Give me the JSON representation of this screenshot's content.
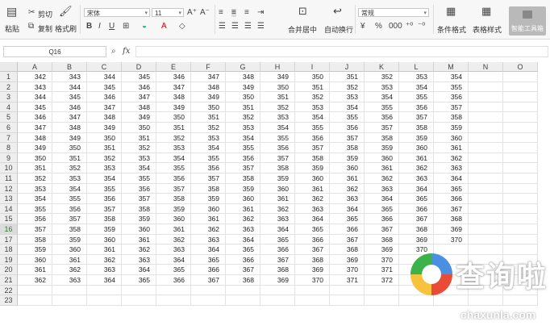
{
  "ribbon": {
    "paste": "粘贴",
    "cut": "剪切",
    "copy": "复制",
    "format_painter": "格式刷",
    "font_name": "宋体",
    "font_size": "11",
    "merge_center": "合并居中",
    "wrap_text": "自动换行",
    "number_format": "常规",
    "conditional_format": "条件格式",
    "table_style": "表格样式",
    "smart_toolbox": "智能工具箱",
    "icons": [
      "paste-icon",
      "cut-icon",
      "copy-icon",
      "format-painter-icon",
      "bold-icon",
      "italic-icon",
      "underline-icon",
      "border-icon",
      "fill-color-icon",
      "font-color-icon",
      "clear-icon",
      "align-icon",
      "currency-icon",
      "percent-icon",
      "thousands-icon",
      "decimal-icon"
    ]
  },
  "formula_bar": {
    "name_box": "Q16",
    "fx_label": "fx",
    "formula": ""
  },
  "sheet": {
    "columns": [
      "A",
      "B",
      "C",
      "D",
      "E",
      "F",
      "G",
      "H",
      "I",
      "J",
      "K",
      "L",
      "M",
      "N",
      "O"
    ],
    "row_numbers": [
      "1",
      "2",
      "3",
      "4",
      "5",
      "6",
      "7",
      "8",
      "9",
      "10",
      "11",
      "12",
      "13",
      "14",
      "15",
      "16",
      "17",
      "18",
      "19",
      "20",
      "21",
      "22",
      "23"
    ],
    "active_cell": "Q16",
    "active_row": "16",
    "rows": [
      [
        "342",
        "343",
        "344",
        "345",
        "346",
        "347",
        "348",
        "349",
        "350",
        "351",
        "352",
        "353",
        "354"
      ],
      [
        "343",
        "344",
        "345",
        "346",
        "347",
        "348",
        "349",
        "350",
        "351",
        "352",
        "353",
        "354",
        "355"
      ],
      [
        "344",
        "345",
        "346",
        "347",
        "348",
        "349",
        "350",
        "351",
        "352",
        "353",
        "354",
        "355",
        "356"
      ],
      [
        "345",
        "346",
        "347",
        "348",
        "349",
        "350",
        "351",
        "352",
        "353",
        "354",
        "355",
        "356",
        "357"
      ],
      [
        "346",
        "347",
        "348",
        "349",
        "350",
        "351",
        "352",
        "353",
        "354",
        "355",
        "356",
        "357",
        "358"
      ],
      [
        "347",
        "348",
        "349",
        "350",
        "351",
        "352",
        "353",
        "354",
        "355",
        "356",
        "357",
        "358",
        "359"
      ],
      [
        "348",
        "349",
        "350",
        "351",
        "352",
        "353",
        "354",
        "355",
        "356",
        "357",
        "358",
        "359",
        "360"
      ],
      [
        "349",
        "350",
        "351",
        "352",
        "353",
        "354",
        "355",
        "356",
        "357",
        "358",
        "359",
        "360",
        "361"
      ],
      [
        "350",
        "351",
        "352",
        "353",
        "354",
        "355",
        "356",
        "357",
        "358",
        "359",
        "360",
        "361",
        "362"
      ],
      [
        "351",
        "352",
        "353",
        "354",
        "355",
        "356",
        "357",
        "358",
        "359",
        "360",
        "361",
        "362",
        "363"
      ],
      [
        "352",
        "353",
        "354",
        "355",
        "356",
        "357",
        "358",
        "359",
        "360",
        "361",
        "362",
        "363",
        "364"
      ],
      [
        "353",
        "354",
        "355",
        "356",
        "357",
        "358",
        "359",
        "360",
        "361",
        "362",
        "363",
        "364",
        "365"
      ],
      [
        "354",
        "355",
        "356",
        "357",
        "358",
        "359",
        "360",
        "361",
        "362",
        "363",
        "364",
        "365",
        "366"
      ],
      [
        "355",
        "356",
        "357",
        "358",
        "359",
        "360",
        "361",
        "362",
        "363",
        "364",
        "365",
        "366",
        "367"
      ],
      [
        "356",
        "357",
        "358",
        "359",
        "360",
        "361",
        "362",
        "363",
        "364",
        "365",
        "366",
        "367",
        "368"
      ],
      [
        "357",
        "358",
        "359",
        "360",
        "361",
        "362",
        "363",
        "364",
        "365",
        "366",
        "367",
        "368",
        "369"
      ],
      [
        "358",
        "359",
        "360",
        "361",
        "362",
        "363",
        "364",
        "365",
        "366",
        "367",
        "368",
        "369",
        "370"
      ],
      [
        "359",
        "360",
        "361",
        "362",
        "363",
        "364",
        "365",
        "366",
        "367",
        "368",
        "369",
        "370",
        ""
      ],
      [
        "360",
        "361",
        "362",
        "363",
        "364",
        "365",
        "366",
        "367",
        "368",
        "369",
        "370",
        "",
        ""
      ],
      [
        "361",
        "362",
        "363",
        "364",
        "365",
        "366",
        "367",
        "368",
        "369",
        "370",
        "371",
        "",
        ""
      ],
      [
        "362",
        "363",
        "364",
        "365",
        "366",
        "367",
        "368",
        "369",
        "370",
        "371",
        "372",
        "",
        ""
      ],
      [
        "",
        "",
        "",
        "",
        "",
        "",
        "",
        "",
        "",
        "",
        "",
        "",
        ""
      ],
      [
        "",
        "",
        "",
        "",
        "",
        "",
        "",
        "",
        "",
        "",
        "",
        "",
        ""
      ]
    ]
  },
  "watermark": {
    "brand_cn": "查询啦",
    "brand_en": "chaxunla.com"
  },
  "colors": {
    "active_green": "#2e7d32",
    "header_gray": "#eeeeee"
  }
}
